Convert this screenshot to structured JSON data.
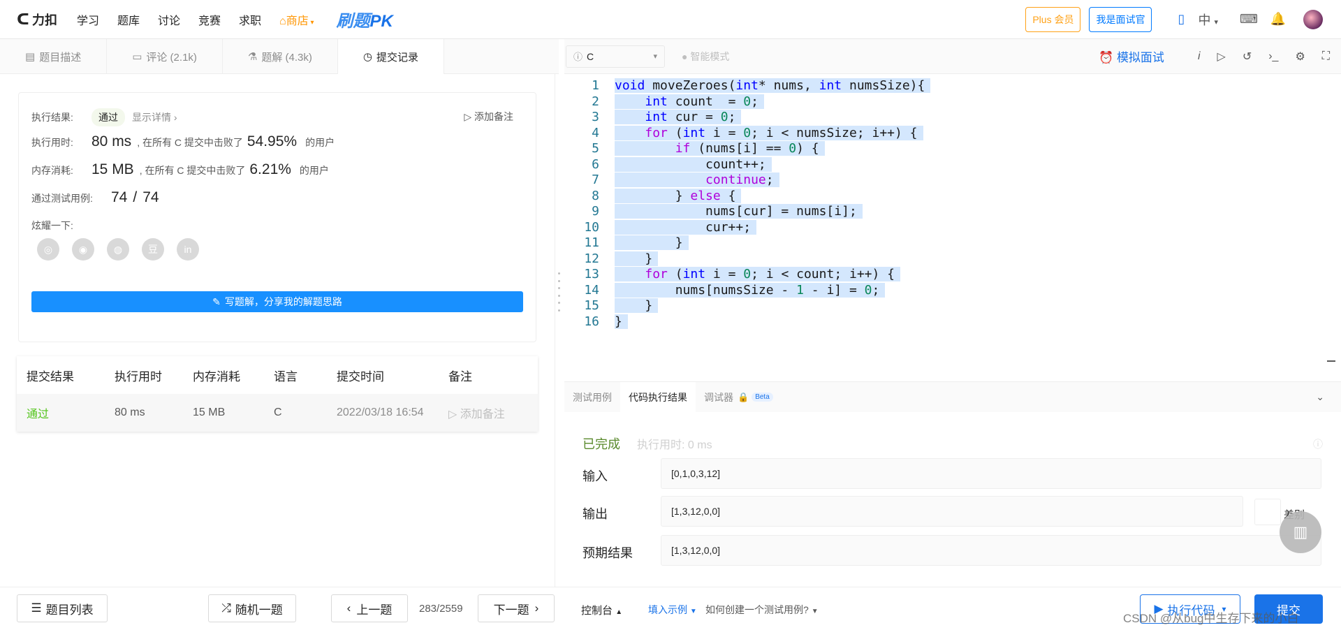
{
  "topnav": {
    "brand": "力扣",
    "items": [
      "学习",
      "题库",
      "讨论",
      "竞赛",
      "求职"
    ],
    "shop": "商店",
    "pk_brand_a": "刷题",
    "pk_brand_b": "PK",
    "plus_button": "Plus 会员",
    "interviewer_button": "我是面试官",
    "language": "中"
  },
  "left_tabs": [
    "题目描述",
    "评论 (2.1k)",
    "题解 (4.3k)",
    "提交记录"
  ],
  "result": {
    "label_result": "执行结果:",
    "status": "通过",
    "show_detail": "显示详情",
    "add_note": "添加备注",
    "label_time": "执行用时:",
    "time_value": "80 ms",
    "time_mid": ", 在所有 C 提交中击败了",
    "time_pct": "54.95%",
    "time_tail": "的用户",
    "label_mem": "内存消耗:",
    "mem_value": "15 MB",
    "mem_mid": ", 在所有 C 提交中击败了",
    "mem_pct": "6.21%",
    "mem_tail": "的用户",
    "label_cases": "通过测试用例:",
    "cases_passed": "74",
    "cases_sep": "/",
    "cases_total": "74",
    "label_share": "炫耀一下:",
    "share_icons": [
      "wechat-icon",
      "weibo-icon",
      "qq-icon",
      "douban-icon",
      "linkedin-icon"
    ],
    "share_glyphs": [
      "◎",
      "◉",
      "◍",
      "豆",
      "in"
    ],
    "write_button": "写题解，分享我的解题思路"
  },
  "submissions": {
    "headers": [
      "提交结果",
      "执行用时",
      "内存消耗",
      "语言",
      "提交时间",
      "备注"
    ],
    "rows": [
      {
        "result": "通过",
        "time": "80 ms",
        "memory": "15 MB",
        "language": "C",
        "submitted_at": "2022/03/18 16:54",
        "note": "添加备注"
      }
    ]
  },
  "editor": {
    "language": "C",
    "smart_mode": "智能模式",
    "mock_interview": "模拟面试",
    "line_numbers": [
      "1",
      "2",
      "3",
      "4",
      "5",
      "6",
      "7",
      "8",
      "9",
      "10",
      "11",
      "12",
      "13",
      "14",
      "15",
      "16"
    ],
    "code_lines": [
      [
        {
          "t": "void",
          "c": "kw"
        },
        {
          "t": " moveZeroes("
        },
        {
          "t": "int",
          "c": "kw"
        },
        {
          "t": "* nums, "
        },
        {
          "t": "int",
          "c": "kw"
        },
        {
          "t": " numsSize){"
        }
      ],
      [
        {
          "t": "    "
        },
        {
          "t": "int",
          "c": "kw"
        },
        {
          "t": " count  = "
        },
        {
          "t": "0",
          "c": "num"
        },
        {
          "t": ";"
        }
      ],
      [
        {
          "t": "    "
        },
        {
          "t": "int",
          "c": "kw"
        },
        {
          "t": " cur = "
        },
        {
          "t": "0",
          "c": "num"
        },
        {
          "t": ";"
        }
      ],
      [
        {
          "t": "    "
        },
        {
          "t": "for",
          "c": "kwc"
        },
        {
          "t": " ("
        },
        {
          "t": "int",
          "c": "kw"
        },
        {
          "t": " i = "
        },
        {
          "t": "0",
          "c": "num"
        },
        {
          "t": "; i < numsSize; i++) {"
        }
      ],
      [
        {
          "t": "        "
        },
        {
          "t": "if",
          "c": "kwc"
        },
        {
          "t": " (nums[i] == "
        },
        {
          "t": "0",
          "c": "num"
        },
        {
          "t": ") {"
        }
      ],
      [
        {
          "t": "            count++;"
        }
      ],
      [
        {
          "t": "            "
        },
        {
          "t": "continue",
          "c": "kwc"
        },
        {
          "t": ";"
        }
      ],
      [
        {
          "t": "        } "
        },
        {
          "t": "else",
          "c": "kwc"
        },
        {
          "t": " {"
        }
      ],
      [
        {
          "t": "            nums[cur] = nums[i];"
        }
      ],
      [
        {
          "t": "            cur++;"
        }
      ],
      [
        {
          "t": "        }"
        }
      ],
      [
        {
          "t": "    }"
        }
      ],
      [
        {
          "t": "    "
        },
        {
          "t": "for",
          "c": "kwc"
        },
        {
          "t": " ("
        },
        {
          "t": "int",
          "c": "kw"
        },
        {
          "t": " i = "
        },
        {
          "t": "0",
          "c": "num"
        },
        {
          "t": "; i < count; i++) {"
        }
      ],
      [
        {
          "t": "        nums[numsSize - "
        },
        {
          "t": "1",
          "c": "num"
        },
        {
          "t": " - i] = "
        },
        {
          "t": "0",
          "c": "num"
        },
        {
          "t": ";"
        }
      ],
      [
        {
          "t": "    }"
        }
      ],
      [
        {
          "t": "}"
        }
      ]
    ]
  },
  "console": {
    "tabs": [
      "测试用例",
      "代码执行结果",
      "调试器"
    ],
    "beta": "Beta",
    "status": "已完成",
    "exec_time": "执行用时: 0 ms",
    "input_label": "输入",
    "input_value": "[0,1,0,3,12]",
    "output_label": "输出",
    "output_value": "[1,3,12,0,0]",
    "diff_label": "差别",
    "expected_label": "预期结果",
    "expected_value": "[1,3,12,0,0]"
  },
  "bottom": {
    "problem_list": "题目列表",
    "random": "随机一题",
    "prev": "上一题",
    "pager": "283/2559",
    "next": "下一题",
    "console": "控制台",
    "fill_example": "填入示例",
    "how_create": "如何创建一个测试用例?",
    "run": "执行代码",
    "submit": "提交",
    "watermark": "CSDN @从bug中生存下来的小白"
  }
}
